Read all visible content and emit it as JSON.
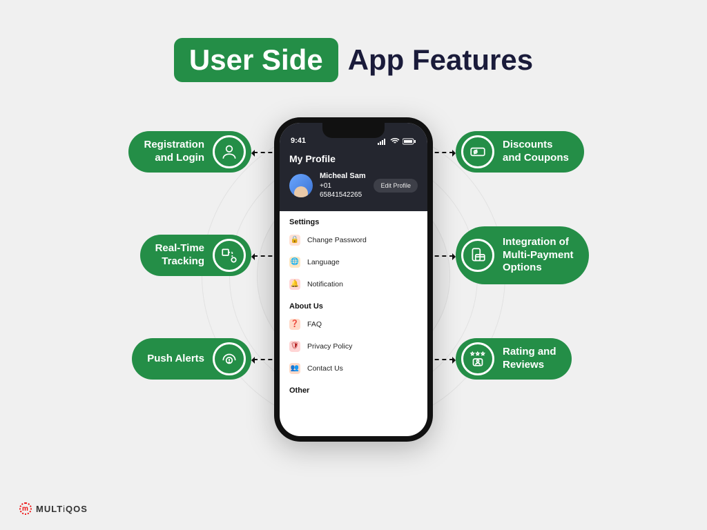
{
  "title": {
    "badge": "User Side",
    "rest": "App Features"
  },
  "features": {
    "left": [
      {
        "label": "Registration\nand Login",
        "icon": "user-icon"
      },
      {
        "label": "Real-Time\nTracking",
        "icon": "tracking-icon"
      },
      {
        "label": "Push Alerts",
        "icon": "alert-icon"
      }
    ],
    "right": [
      {
        "label": "Discounts\nand Coupons",
        "icon": "coupon-icon"
      },
      {
        "label": "Integration of\nMulti-Payment\nOptions",
        "icon": "payment-icon"
      },
      {
        "label": "Rating and\nReviews",
        "icon": "rating-icon"
      }
    ]
  },
  "phone": {
    "time": "9:41",
    "screen_title": "My Profile",
    "user": {
      "name": "Micheal Sam",
      "phone": "+01 65841542265"
    },
    "edit_label": "Edit Profile",
    "sections": {
      "settings_title": "Settings",
      "settings": [
        {
          "label": "Change Password",
          "icon": "lock"
        },
        {
          "label": "Language",
          "icon": "globe"
        },
        {
          "label": "Notification",
          "icon": "bell"
        }
      ],
      "about_title": "About Us",
      "about": [
        {
          "label": "FAQ",
          "icon": "faq"
        },
        {
          "label": "Privacy Policy",
          "icon": "shield"
        },
        {
          "label": "Contact Us",
          "icon": "people"
        }
      ],
      "other_title": "Other"
    }
  },
  "brand": {
    "name": "MULTIQOS"
  },
  "colors": {
    "green": "#248e47",
    "navy": "#1a1b3a"
  }
}
